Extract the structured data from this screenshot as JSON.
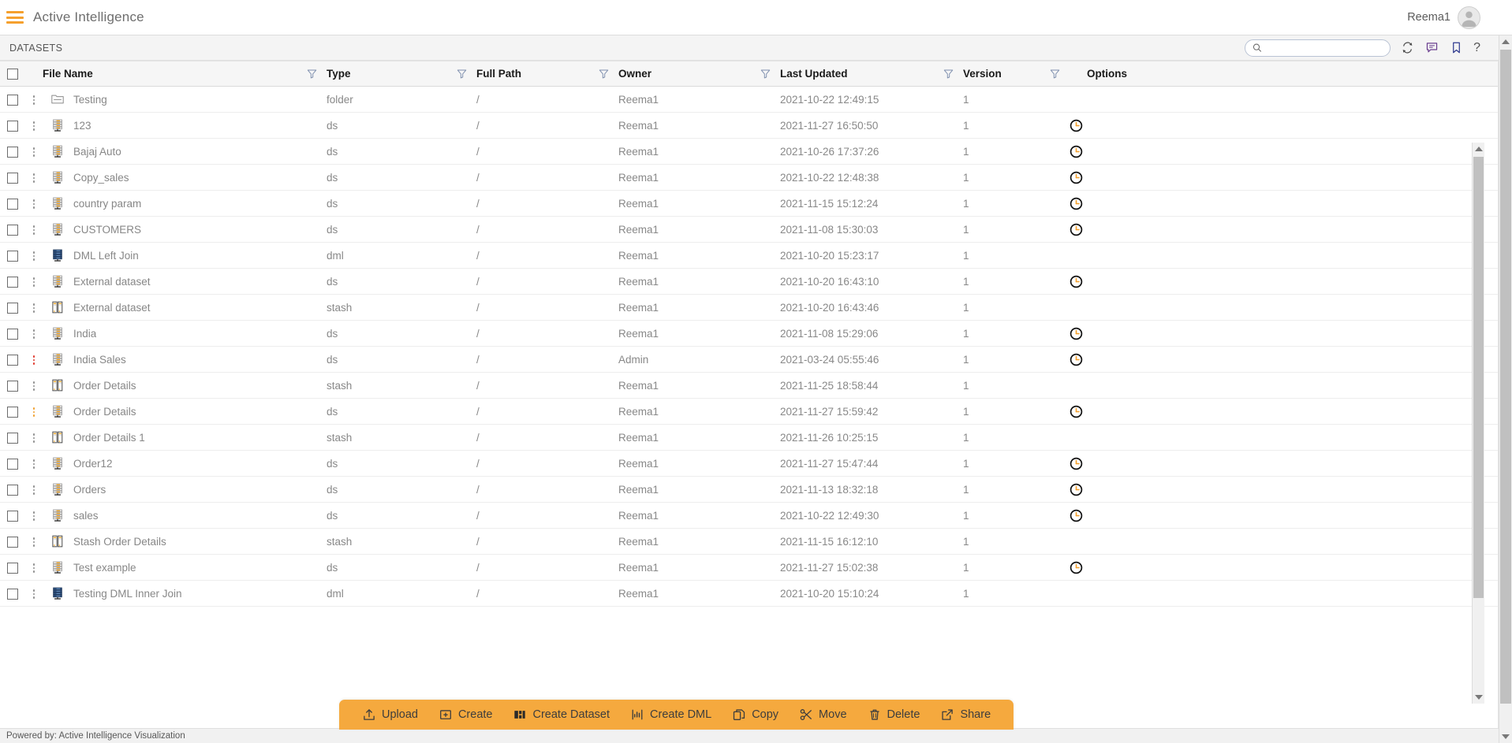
{
  "header": {
    "menu_icon": "hamburger-icon",
    "title": "Active Intelligence",
    "user_name": "Reema1",
    "avatar_icon": "user-avatar-icon"
  },
  "subheader": {
    "breadcrumb": "DATASETS",
    "search": {
      "value": "",
      "placeholder": ""
    },
    "icons": [
      {
        "name": "refresh-icon"
      },
      {
        "name": "comment-icon"
      },
      {
        "name": "bookmark-icon"
      },
      {
        "name": "help-icon",
        "glyph": "?"
      }
    ]
  },
  "table": {
    "columns": [
      {
        "key": "name",
        "label": "File Name",
        "filter": true
      },
      {
        "key": "type",
        "label": "Type",
        "filter": true
      },
      {
        "key": "path",
        "label": "Full Path",
        "filter": true
      },
      {
        "key": "owner",
        "label": "Owner",
        "filter": true
      },
      {
        "key": "date",
        "label": "Last Updated",
        "filter": true
      },
      {
        "key": "ver",
        "label": "Version",
        "filter": true
      },
      {
        "key": "opt",
        "label": "Options",
        "filter": false
      }
    ],
    "rows": [
      {
        "name": "Testing",
        "icon": "folder-icon",
        "type": "folder",
        "path": "/",
        "owner": "Reema1",
        "date": "2021-10-22 12:49:15",
        "version": "1",
        "option": false,
        "dots_color": "gray"
      },
      {
        "name": "123",
        "icon": "dataset-icon",
        "type": "ds",
        "path": "/",
        "owner": "Reema1",
        "date": "2021-11-27 16:50:50",
        "version": "1",
        "option": true,
        "dots_color": "gray"
      },
      {
        "name": "Bajaj Auto",
        "icon": "dataset-icon",
        "type": "ds",
        "path": "/",
        "owner": "Reema1",
        "date": "2021-10-26 17:37:26",
        "version": "1",
        "option": true,
        "dots_color": "gray"
      },
      {
        "name": "Copy_sales",
        "icon": "dataset-icon",
        "type": "ds",
        "path": "/",
        "owner": "Reema1",
        "date": "2021-10-22 12:48:38",
        "version": "1",
        "option": true,
        "dots_color": "gray"
      },
      {
        "name": "country param",
        "icon": "dataset-icon",
        "type": "ds",
        "path": "/",
        "owner": "Reema1",
        "date": "2021-11-15 15:12:24",
        "version": "1",
        "option": true,
        "dots_color": "gray"
      },
      {
        "name": "CUSTOMERS",
        "icon": "dataset-icon",
        "type": "ds",
        "path": "/",
        "owner": "Reema1",
        "date": "2021-11-08 15:30:03",
        "version": "1",
        "option": true,
        "dots_color": "gray"
      },
      {
        "name": "DML Left Join",
        "icon": "dml-icon",
        "type": "dml",
        "path": "/",
        "owner": "Reema1",
        "date": "2021-10-20 15:23:17",
        "version": "1",
        "option": false,
        "dots_color": "gray"
      },
      {
        "name": "External dataset",
        "icon": "dataset-icon",
        "type": "ds",
        "path": "/",
        "owner": "Reema1",
        "date": "2021-10-20 16:43:10",
        "version": "1",
        "option": true,
        "dots_color": "gray"
      },
      {
        "name": "External dataset",
        "icon": "stash-icon",
        "type": "stash",
        "path": "/",
        "owner": "Reema1",
        "date": "2021-10-20 16:43:46",
        "version": "1",
        "option": false,
        "dots_color": "gray"
      },
      {
        "name": "India",
        "icon": "dataset-icon",
        "type": "ds",
        "path": "/",
        "owner": "Reema1",
        "date": "2021-11-08 15:29:06",
        "version": "1",
        "option": true,
        "dots_color": "gray"
      },
      {
        "name": "India Sales",
        "icon": "dataset-icon",
        "type": "ds",
        "path": "/",
        "owner": "Admin",
        "date": "2021-03-24 05:55:46",
        "version": "1",
        "option": true,
        "dots_color": "red"
      },
      {
        "name": "Order Details",
        "icon": "stash-icon",
        "type": "stash",
        "path": "/",
        "owner": "Reema1",
        "date": "2021-11-25 18:58:44",
        "version": "1",
        "option": false,
        "dots_color": "gray"
      },
      {
        "name": "Order Details",
        "icon": "dataset-icon",
        "type": "ds",
        "path": "/",
        "owner": "Reema1",
        "date": "2021-11-27 15:59:42",
        "version": "1",
        "option": true,
        "dots_color": "orange"
      },
      {
        "name": "Order Details 1",
        "icon": "stash-icon",
        "type": "stash",
        "path": "/",
        "owner": "Reema1",
        "date": "2021-11-26 10:25:15",
        "version": "1",
        "option": false,
        "dots_color": "gray"
      },
      {
        "name": "Order12",
        "icon": "dataset-icon",
        "type": "ds",
        "path": "/",
        "owner": "Reema1",
        "date": "2021-11-27 15:47:44",
        "version": "1",
        "option": true,
        "dots_color": "gray"
      },
      {
        "name": "Orders",
        "icon": "dataset-icon",
        "type": "ds",
        "path": "/",
        "owner": "Reema1",
        "date": "2021-11-13 18:32:18",
        "version": "1",
        "option": true,
        "dots_color": "gray"
      },
      {
        "name": "sales",
        "icon": "dataset-icon",
        "type": "ds",
        "path": "/",
        "owner": "Reema1",
        "date": "2021-10-22 12:49:30",
        "version": "1",
        "option": true,
        "dots_color": "gray"
      },
      {
        "name": "Stash Order Details",
        "icon": "stash-icon",
        "type": "stash",
        "path": "/",
        "owner": "Reema1",
        "date": "2021-11-15 16:12:10",
        "version": "1",
        "option": false,
        "dots_color": "gray"
      },
      {
        "name": "Test example",
        "icon": "dataset-icon",
        "type": "ds",
        "path": "/",
        "owner": "Reema1",
        "date": "2021-11-27 15:02:38",
        "version": "1",
        "option": true,
        "dots_color": "gray"
      },
      {
        "name": "Testing DML Inner Join",
        "icon": "dml-icon",
        "type": "dml",
        "path": "/",
        "owner": "Reema1",
        "date": "2021-10-20 15:10:24",
        "version": "1",
        "option": false,
        "dots_color": "gray"
      }
    ]
  },
  "actionbar": {
    "items": [
      {
        "label": "Upload",
        "icon": "upload-icon"
      },
      {
        "label": "Create",
        "icon": "create-folder-icon"
      },
      {
        "label": "Create Dataset",
        "icon": "create-dataset-icon"
      },
      {
        "label": "Create DML",
        "icon": "create-dml-icon"
      },
      {
        "label": "Copy",
        "icon": "copy-icon"
      },
      {
        "label": "Move",
        "icon": "scissors-icon"
      },
      {
        "label": "Delete",
        "icon": "trash-icon"
      },
      {
        "label": "Share",
        "icon": "share-icon"
      }
    ]
  },
  "footer": {
    "text": "Powered by: Active Intelligence Visualization"
  },
  "colors": {
    "accent": "#f5a02d",
    "actionbar": "#f5a93e",
    "header_bg": "#ffffff",
    "subbar_bg": "#f4f4f4",
    "text": "#888888",
    "alert_red": "#e03a2f"
  }
}
